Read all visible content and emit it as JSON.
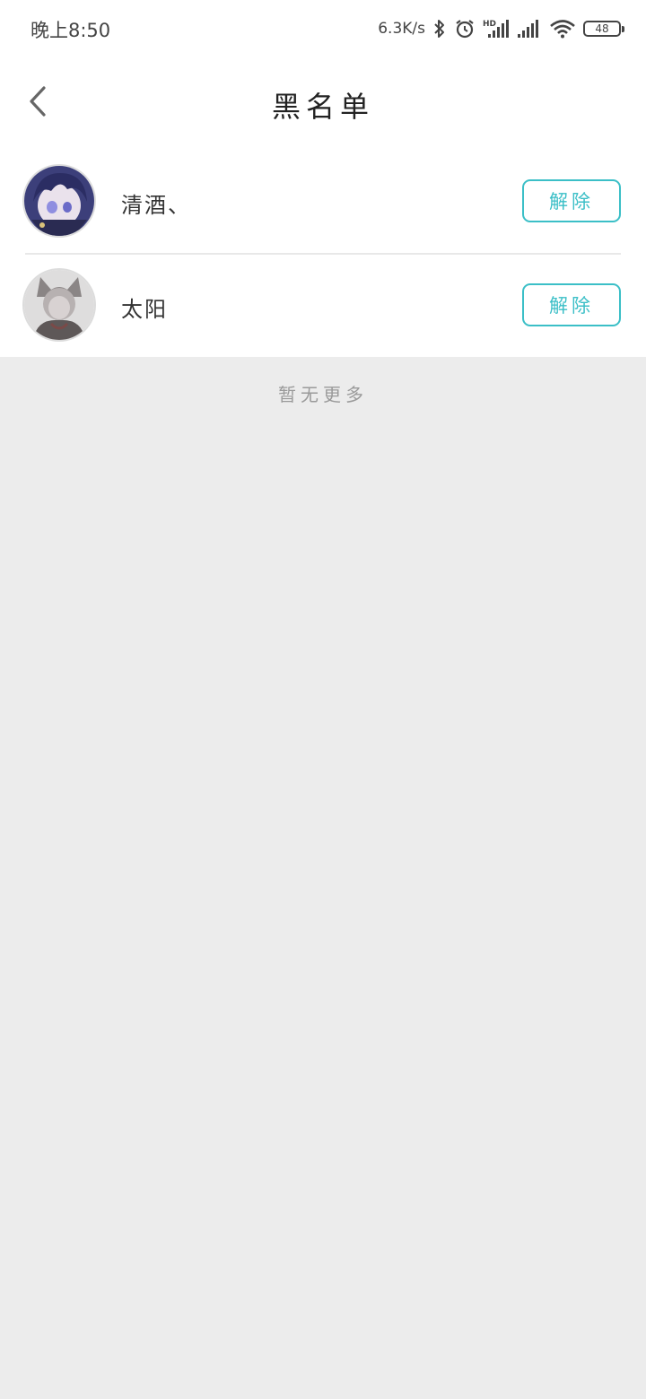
{
  "status_bar": {
    "time": "晚上8:50",
    "net_speed": "6.3K/s",
    "battery": "48",
    "icons": [
      "bluetooth-icon",
      "alarm-icon",
      "hd-signal-icon",
      "signal-icon",
      "wifi-icon",
      "battery-icon"
    ]
  },
  "nav": {
    "title": "黑名单",
    "back_icon": "chevron-left-icon"
  },
  "list": {
    "items": [
      {
        "name": "清酒、",
        "action_label": "解除"
      },
      {
        "name": "太阳",
        "action_label": "解除"
      }
    ]
  },
  "footer": {
    "text": "暂无更多"
  },
  "colors": {
    "accent": "#3bbfc7",
    "background": "#ececec",
    "surface": "#ffffff"
  }
}
